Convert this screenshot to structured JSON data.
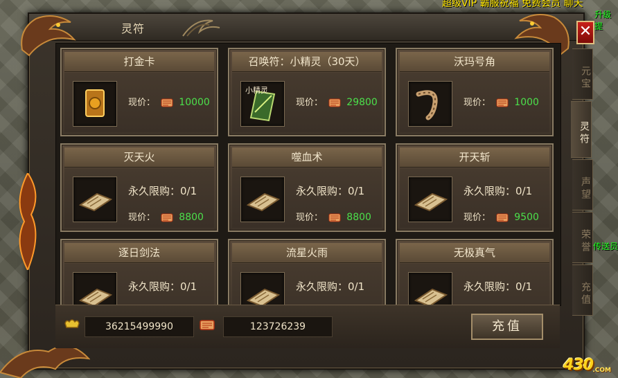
{
  "world": {
    "top_text": "超级VIP  霸服祝福  免费会员  聊天",
    "green_text_top": "升级提",
    "green_text_side": "传送员"
  },
  "watermark": {
    "number": "430",
    "suffix": ".COM"
  },
  "window": {
    "title": "灵符",
    "close_label": "✕"
  },
  "tabs": [
    {
      "label": "元宝",
      "active": false
    },
    {
      "label": "灵符",
      "active": true
    },
    {
      "label": "声望",
      "active": false
    },
    {
      "label": "荣誉",
      "active": false
    },
    {
      "label": "充值",
      "active": false
    }
  ],
  "price_label": "现价：",
  "limit_label": "永久限购：",
  "cards": [
    {
      "name": "打金卡",
      "price": "10000",
      "limit": null,
      "icon": "gold-card-icon"
    },
    {
      "name": "召唤符：小精灵（30天）",
      "price": "29800",
      "limit": null,
      "icon": "summon-talisman-icon",
      "slot_text": "小精灵"
    },
    {
      "name": "沃玛号角",
      "price": "1000",
      "limit": null,
      "icon": "woma-horn-icon"
    },
    {
      "name": "灭天火",
      "price": "8800",
      "limit": "0/1",
      "icon": "skill-book-icon"
    },
    {
      "name": "噬血术",
      "price": "8800",
      "limit": "0/1",
      "icon": "skill-book-icon"
    },
    {
      "name": "开天斩",
      "price": "9500",
      "limit": "0/1",
      "icon": "skill-book-icon"
    },
    {
      "name": "逐日剑法",
      "price": "",
      "limit": "0/1",
      "icon": "skill-book-icon"
    },
    {
      "name": "流星火雨",
      "price": "",
      "limit": "0/1",
      "icon": "skill-book-icon"
    },
    {
      "name": "无极真气",
      "price": "",
      "limit": "0/1",
      "icon": "skill-book-icon"
    }
  ],
  "balances": {
    "gold": "36215499990",
    "coupons": "123726239"
  },
  "recharge_label": "充值",
  "colors": {
    "price_green": "#4be04b",
    "close_red": "#c8201a",
    "title_text": "#e8d9b8"
  }
}
